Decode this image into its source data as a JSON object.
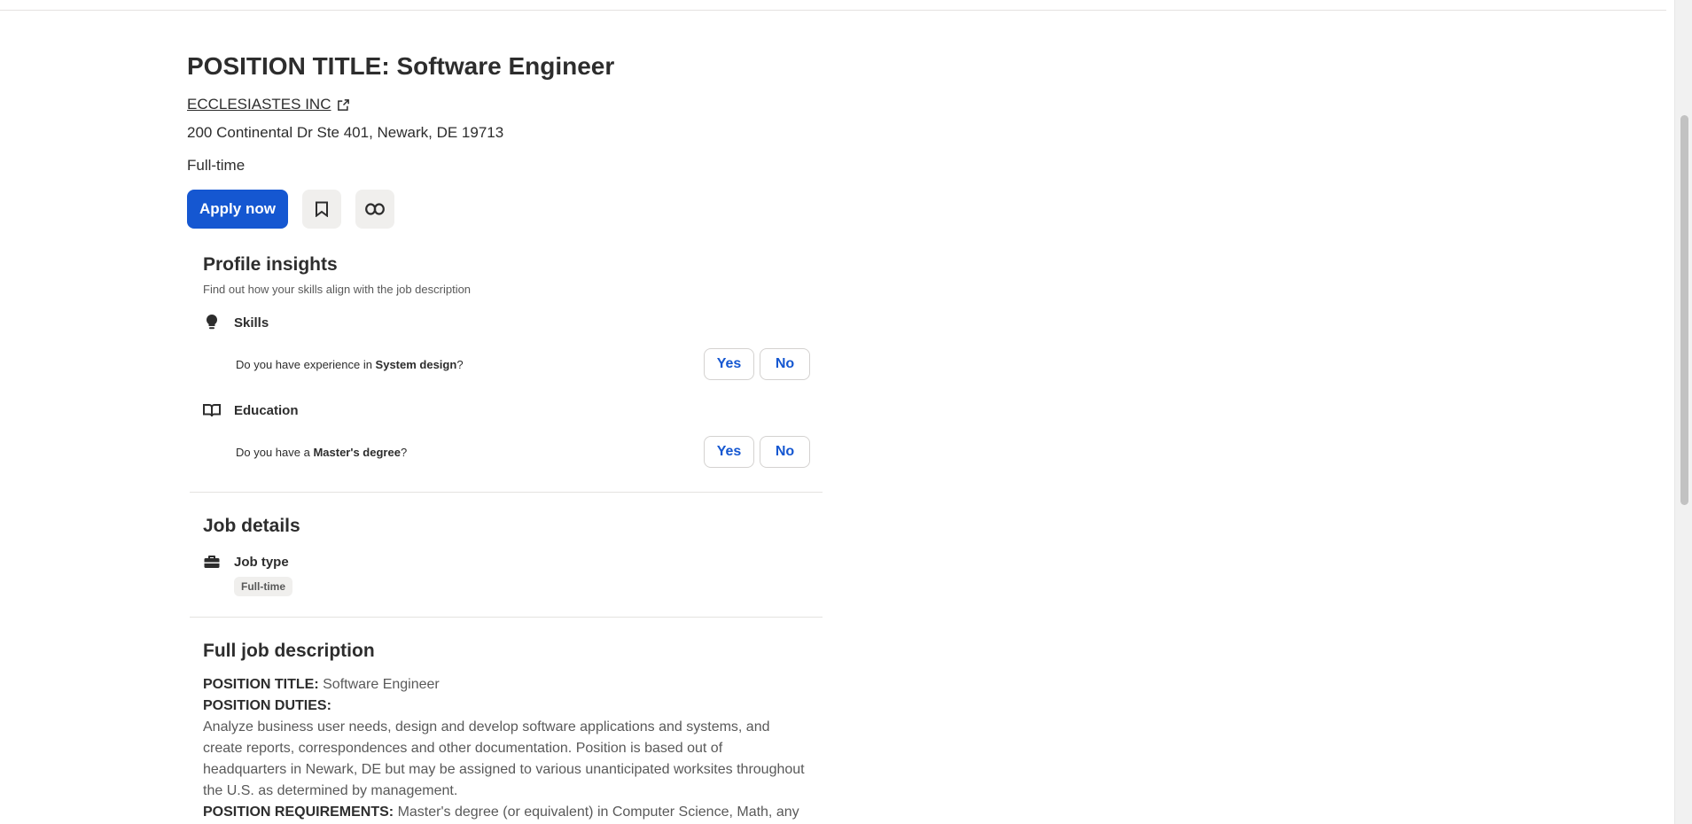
{
  "job": {
    "title": "POSITION TITLE: Software Engineer",
    "company": "ECCLESIASTES INC",
    "address": "200 Continental Dr Ste 401, Newark, DE 19713",
    "job_type": "Full-time"
  },
  "actions": {
    "apply_label": "Apply now",
    "save_icon": "bookmark-icon",
    "share_icon": "link-icon"
  },
  "insights": {
    "heading": "Profile insights",
    "subtitle": "Find out how your skills align with the job description",
    "skills": {
      "label": "Skills",
      "icon": "lightbulb-icon",
      "question_prefix": "Do you have experience in ",
      "question_subject": "System design",
      "question_suffix": "?",
      "yes": "Yes",
      "no": "No"
    },
    "education": {
      "label": "Education",
      "icon": "book-icon",
      "question_prefix": "Do you have a ",
      "question_subject": "Master's degree",
      "question_suffix": "?",
      "yes": "Yes",
      "no": "No"
    }
  },
  "job_details": {
    "heading": "Job details",
    "job_type_label": "Job type",
    "job_type_icon": "briefcase-icon",
    "job_type_value": "Full-time"
  },
  "description": {
    "heading": "Full job description",
    "title_label": "POSITION TITLE:",
    "title_value": " Software Engineer",
    "duties_label": "POSITION DUTIES:",
    "duties_text": "Analyze business user needs, design and develop software applications and systems, and create reports, correspondences and other documentation. Position is based out of headquarters in Newark, DE but may be assigned to various unanticipated worksites throughout the U.S. as determined by management.",
    "requirements_label": "POSITION REQUIREMENTS:",
    "requirements_text": " Master's degree (or equivalent) in Computer Science, Math, any"
  },
  "colors": {
    "accent": "#1557d1",
    "text": "#2d2d2d",
    "muted": "#595959",
    "chip_bg": "#f0efed",
    "divider": "#e4e2e0"
  }
}
